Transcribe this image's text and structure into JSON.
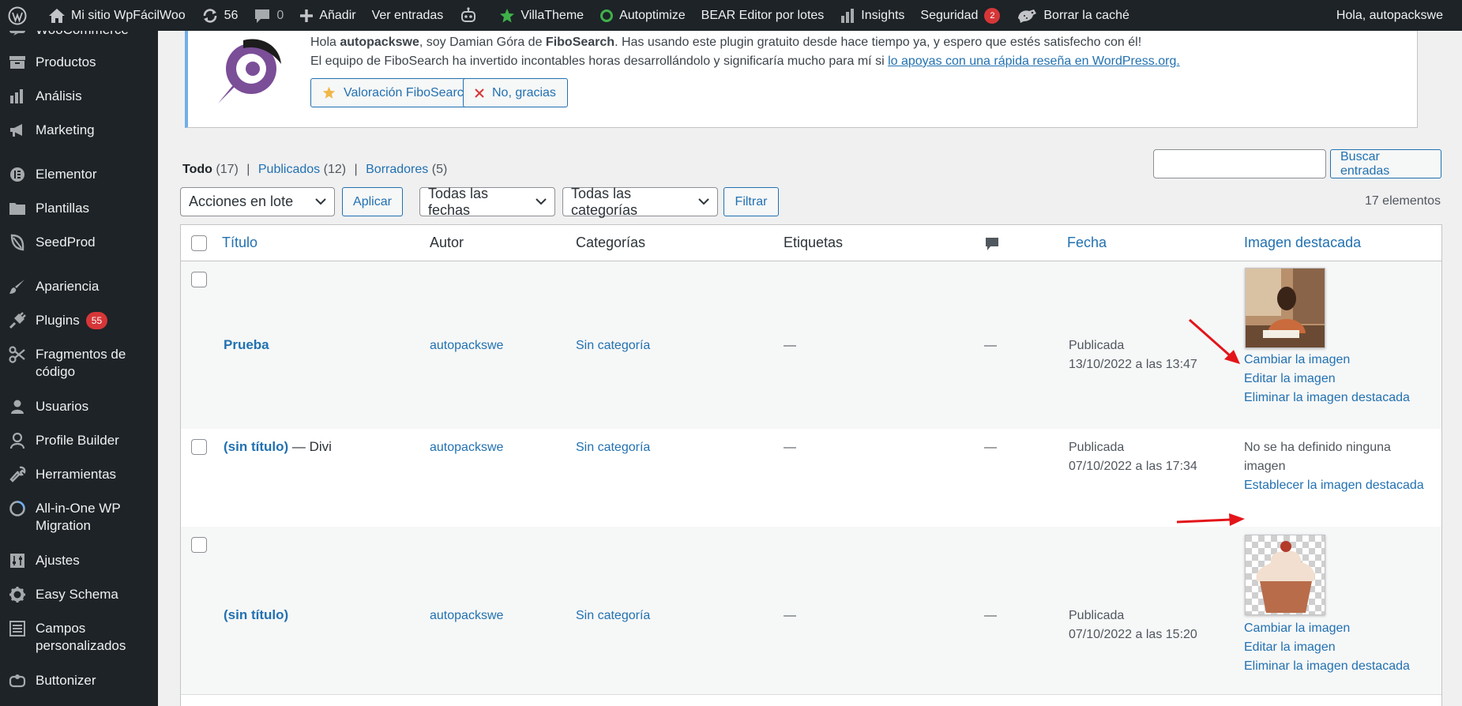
{
  "adminbar": {
    "site_name": "Mi sitio WpFácilWoo",
    "updates_count": "56",
    "comments_count": "0",
    "add_new": "Añadir",
    "view_posts": "Ver entradas",
    "villatheme": "VillaTheme",
    "autoptimize": "Autoptimize",
    "bear": "BEAR Editor por lotes",
    "insights": "Insights",
    "security": "Seguridad",
    "security_count": "2",
    "clear_cache": "Borrar la caché",
    "greeting": "Hola, autopackswe"
  },
  "sidebar": {
    "items": [
      {
        "label": "WooCommerce",
        "icon": "woocommerce-icon"
      },
      {
        "label": "Productos",
        "icon": "archive-icon"
      },
      {
        "label": "Análisis",
        "icon": "bar-chart-icon"
      },
      {
        "label": "Marketing",
        "icon": "megaphone-icon"
      },
      {
        "label": "Elementor",
        "icon": "elementor-icon"
      },
      {
        "label": "Plantillas",
        "icon": "folder-icon"
      },
      {
        "label": "SeedProd",
        "icon": "seedprod-leaf-icon"
      },
      {
        "label": "Apariencia",
        "icon": "paintbrush-icon"
      },
      {
        "label": "Plugins",
        "icon": "plug-icon",
        "badge": "55"
      },
      {
        "label": "Fragmentos de código",
        "icon": "scissors-icon"
      },
      {
        "label": "Usuarios",
        "icon": "user-icon"
      },
      {
        "label": "Profile Builder",
        "icon": "profile-icon"
      },
      {
        "label": "Herramientas",
        "icon": "wrench-icon"
      },
      {
        "label": "All-in-One WP Migration",
        "icon": "migration-icon"
      },
      {
        "label": "Ajustes",
        "icon": "sliders-icon"
      },
      {
        "label": "Easy Schema",
        "icon": "gear-icon"
      },
      {
        "label": "Campos personalizados",
        "icon": "list-icon"
      },
      {
        "label": "Buttonizer",
        "icon": "buttonizer-icon"
      }
    ]
  },
  "notice": {
    "line1_pre": "Hola ",
    "line1_user": "autopackswe",
    "line1_mid": ", soy Damian Góra de ",
    "line1_brand": "FiboSearch",
    "line1_post": ". Has usando este plugin gratuito desde hace tiempo ya, y espero que estés satisfecho con él!",
    "line2_pre": "El equipo de FiboSearch ha invertido incontables horas desarrollándolo y significaría mucho para mí si ",
    "line2_link": "lo apoyas con una rápida reseña en WordPress.org.",
    "rate_button": "Valoración FiboSearch",
    "dismiss_button": "No, gracias"
  },
  "views": {
    "all_label": "Todo",
    "all_count": "(17)",
    "published_label": "Publicados",
    "published_count": "(12)",
    "drafts_label": "Borradores",
    "drafts_count": "(5)",
    "sep": "|"
  },
  "search": {
    "button": "Buscar entradas",
    "placeholder": ""
  },
  "filters": {
    "bulk_actions": "Acciones en lote",
    "apply": "Aplicar",
    "all_dates": "Todas las fechas",
    "all_categories": "Todas las categorías",
    "filter": "Filtrar",
    "items_count": "17 elementos"
  },
  "table": {
    "headers": {
      "title": "Título",
      "author": "Autor",
      "categories": "Categorías",
      "tags": "Etiquetas",
      "date": "Fecha",
      "featured_image": "Imagen destacada"
    },
    "rows": [
      {
        "title": "Prueba",
        "title_suffix": "",
        "author": "autopackswe",
        "category": "Sin categoría",
        "tags": "—",
        "comments": "—",
        "status": "Publicada",
        "date": "13/10/2022 a las 13:47",
        "image_links": [
          "Cambiar la imagen",
          "Editar la imagen",
          "Eliminar la imagen destacada"
        ]
      },
      {
        "title": "(sin título)",
        "title_suffix": " — Divi",
        "author": "autopackswe",
        "category": "Sin categoría",
        "tags": "—",
        "comments": "—",
        "status": "Publicada",
        "date": "07/10/2022 a las 17:34",
        "no_image": "No se ha definido ninguna imagen",
        "image_links": [
          "Establecer la imagen destacada"
        ]
      },
      {
        "title": "(sin título)",
        "title_suffix": "",
        "author": "autopackswe",
        "category": "Sin categoría",
        "tags": "—",
        "comments": "—",
        "status": "Publicada",
        "date": "07/10/2022 a las 15:20",
        "image_links": [
          "Cambiar la imagen",
          "Editar la imagen",
          "Eliminar la imagen destacada"
        ]
      }
    ]
  },
  "colors": {
    "admin_dark": "#1d2327",
    "link": "#2271b1",
    "badge": "#d63638",
    "annotation_arrow": "#e3151a"
  }
}
